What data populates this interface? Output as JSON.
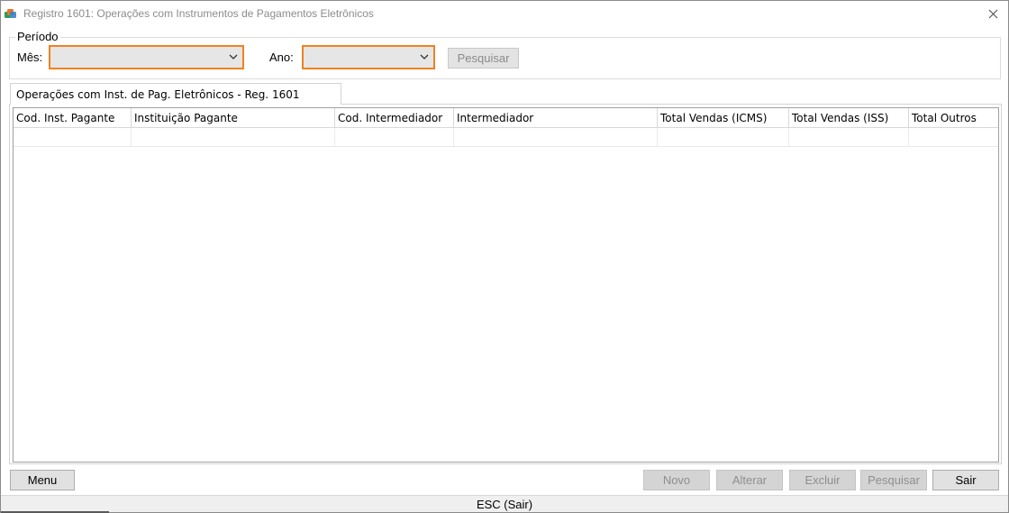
{
  "window": {
    "title": "Registro 1601: Operações com Instrumentos de Pagamentos Eletrônicos",
    "icon": "app-logo-icon",
    "close_icon": "close-icon"
  },
  "periodo": {
    "legend": "Período",
    "mes_label": "Mês:",
    "mes_value": "",
    "ano_label": "Ano:",
    "ano_value": "",
    "search_button": "Pesquisar"
  },
  "tab": {
    "label": "Operações com Inst. de Pag. Eletrônicos - Reg. 1601"
  },
  "table": {
    "columns": [
      "Cod. Inst. Pagante",
      "Instituição Pagante",
      "Cod. Intermediador",
      "Intermediador",
      "Total Vendas (ICMS)",
      "Total Vendas (ISS)",
      "Total Outros"
    ],
    "rows": [
      [
        "",
        "",
        "",
        "",
        "",
        "",
        ""
      ]
    ]
  },
  "footer": {
    "menu": "Menu",
    "novo": "Novo",
    "alterar": "Alterar",
    "excluir": "Excluir",
    "pesquisar": "Pesquisar",
    "sair": "Sair"
  },
  "status": {
    "text": "ESC (Sair)"
  },
  "colors": {
    "accent_border": "#f0821e",
    "disabled_text": "#8e8e8e",
    "title_text": "#8c8c8c"
  }
}
